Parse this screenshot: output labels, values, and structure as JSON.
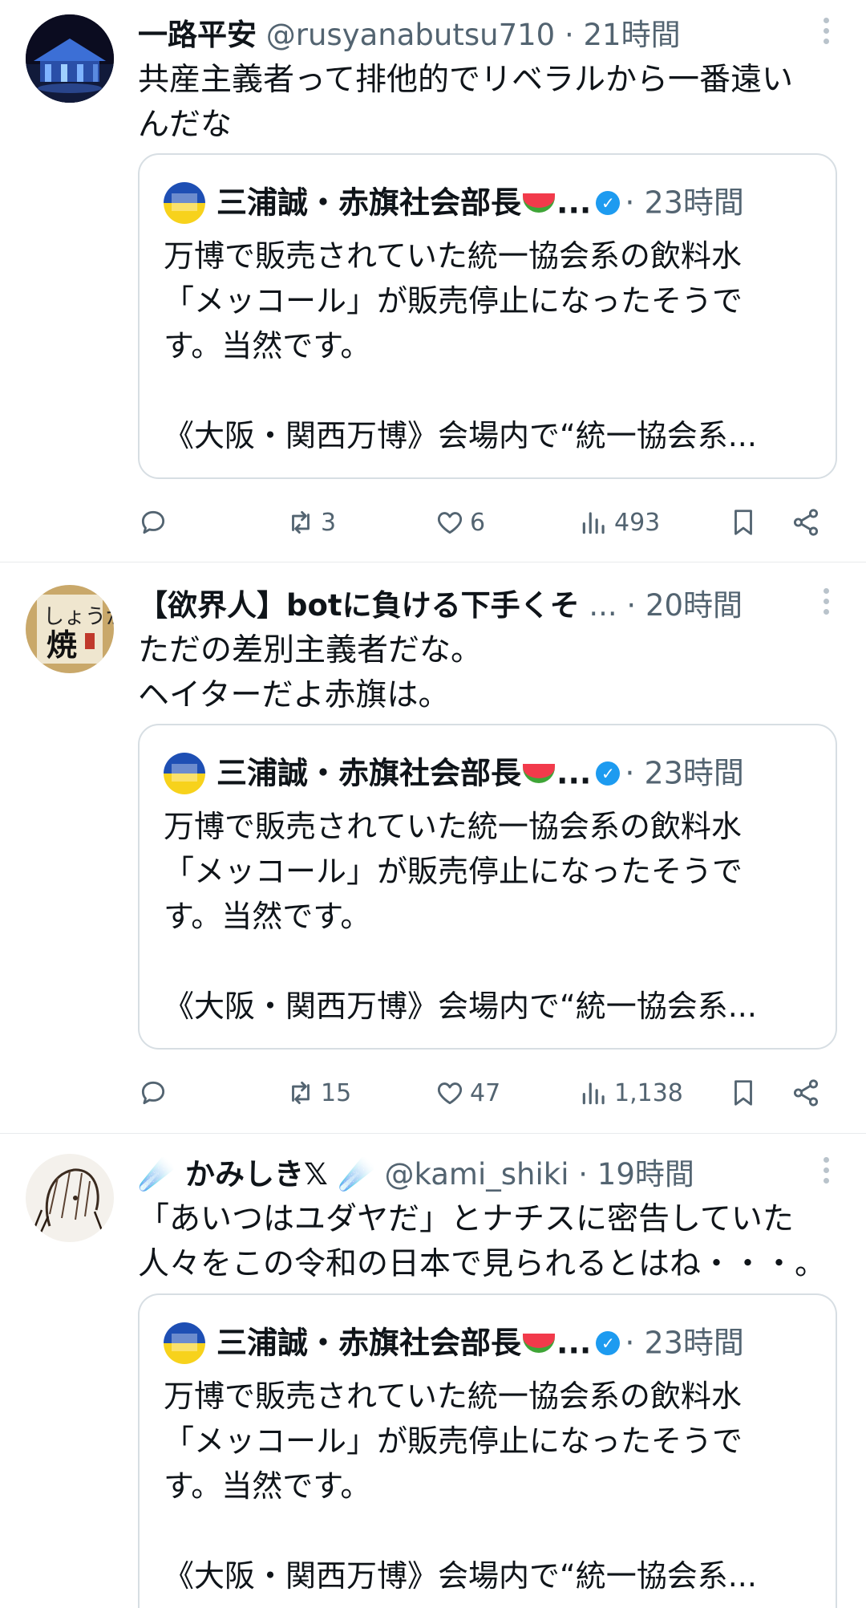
{
  "tweets": [
    {
      "name": "一路平安",
      "handle": "@rusyanabutsu710",
      "dot": "·",
      "time": "21時間",
      "avatar_icon": "night-shrine-avatar",
      "text": "共産主義者って排他的でリベラルから一番遠い\nんだな",
      "quote": {
        "name": "三浦誠・赤旗社会部長",
        "ellipsis": "...",
        "dot": "·",
        "time": "23時間",
        "text": "万博で販売されていた統一協会系の飲料水\n「メッコール」が販売停止になったそうで\nす。当然です。\n\n《大阪・関西万博》会場内で“統一協会系..."
      },
      "stats": {
        "replies": "",
        "retweets": "3",
        "likes": "6",
        "views": "493"
      }
    },
    {
      "name": "【欲界人】botに負ける下手くそ",
      "handle": "...",
      "dot": "·",
      "time": "20時間",
      "avatar_icon": "shoga-yaki-avatar",
      "text": "ただの差別主義者だな。\nヘイターだよ赤旗は。",
      "quote": {
        "name": "三浦誠・赤旗社会部長",
        "ellipsis": "...",
        "dot": "·",
        "time": "23時間",
        "text": "万博で販売されていた統一協会系の飲料水\n「メッコール」が販売停止になったそうで\nす。当然です。\n\n《大阪・関西万博》会場内で“統一協会系..."
      },
      "stats": {
        "replies": "",
        "retweets": "15",
        "likes": "47",
        "views": "1,138"
      }
    },
    {
      "name": "☄️ かみしき𝕏 ☄️",
      "handle": "@kami_shiki",
      "dot": "·",
      "time": "19時間",
      "avatar_icon": "sketch-portrait-avatar",
      "text": "「あいつはユダヤだ」とナチスに密告していた\n人々をこの令和の日本で見られるとはね・・・。",
      "quote": {
        "name": "三浦誠・赤旗社会部長",
        "ellipsis": "...",
        "dot": "·",
        "time": "23時間",
        "text": "万博で販売されていた統一協会系の飲料水\n「メッコール」が販売停止になったそうで\nす。当然です。\n\n《大阪・関西万博》会場内で“統一協会系..."
      },
      "stats": null
    }
  ],
  "colors": {
    "text": "#0f1419",
    "secondary": "#536471",
    "border": "#d7dee3",
    "verified": "#1d9bf0"
  }
}
